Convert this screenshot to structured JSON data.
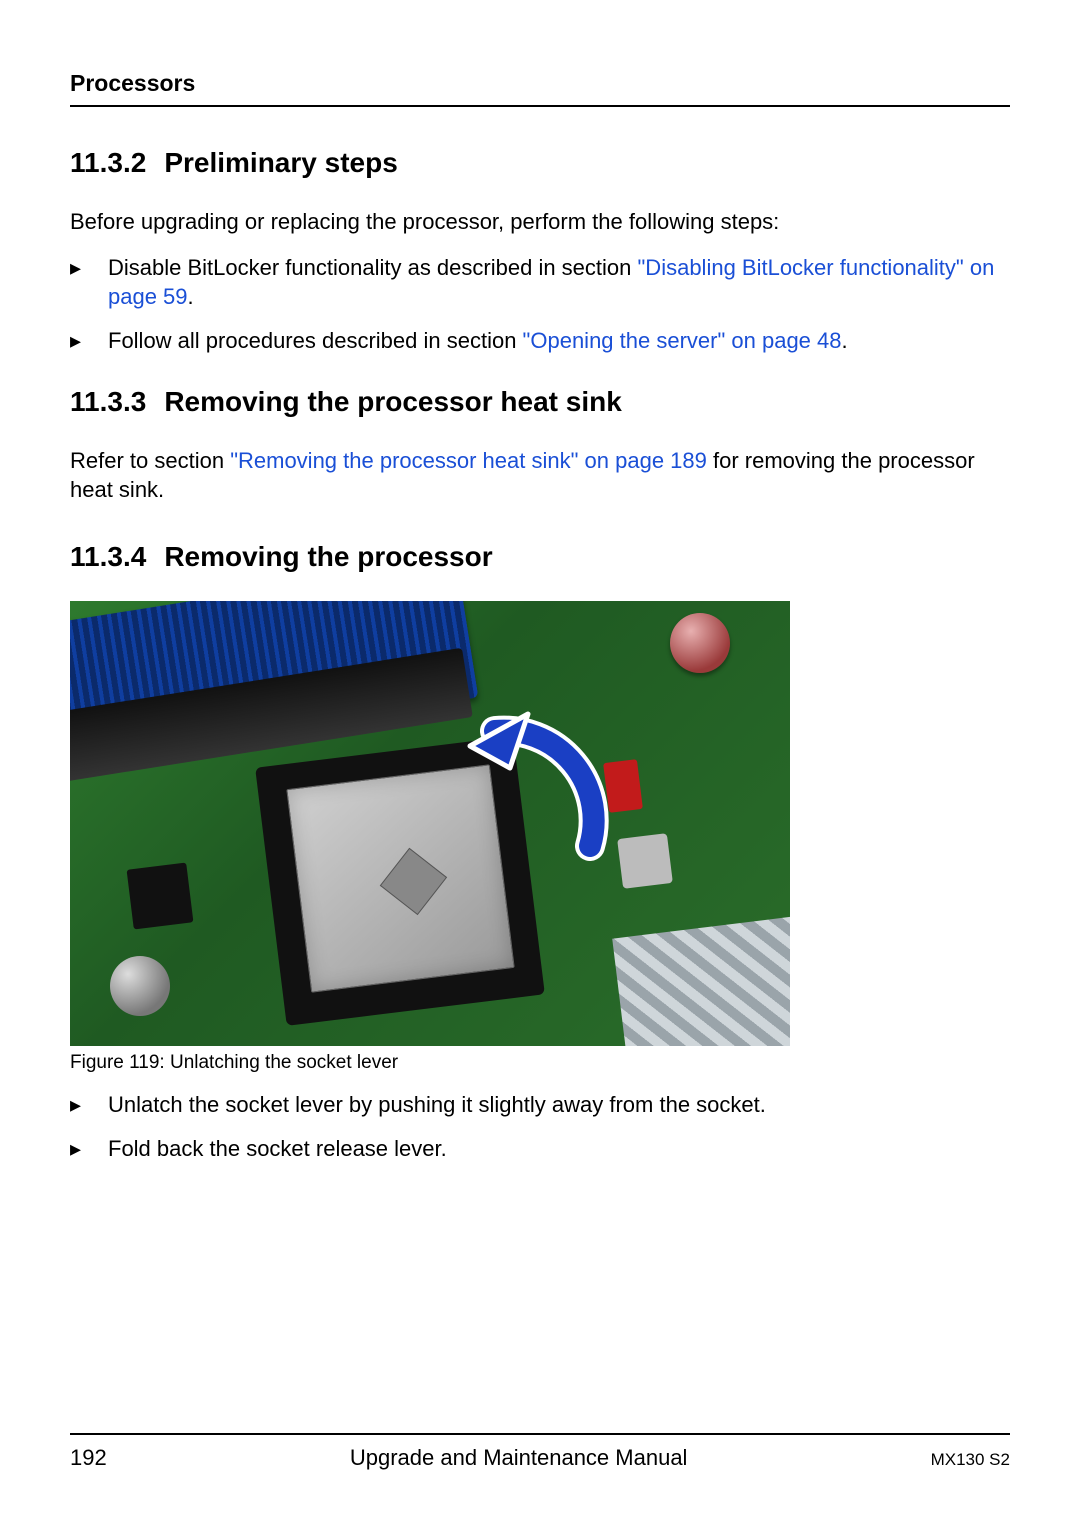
{
  "header": {
    "chapter": "Processors"
  },
  "sections": {
    "s1": {
      "num": "11.3.2",
      "title": "Preliminary steps"
    },
    "s2": {
      "num": "11.3.3",
      "title": "Removing the processor heat sink"
    },
    "s3": {
      "num": "11.3.4",
      "title": "Removing the processor"
    }
  },
  "para": {
    "intro": "Before upgrading or replacing the processor, perform the following steps:",
    "heat_pre": "Refer to section ",
    "heat_link": "\"Removing the processor heat sink\" on page 189",
    "heat_post": " for removing the processor heat sink."
  },
  "bullets1": {
    "b1_pre": "Disable BitLocker functionality as described in section ",
    "b1_link": "\"Disabling BitLocker functionality\" on page 59",
    "b1_post": ".",
    "b2_pre": "Follow all procedures described in section ",
    "b2_link": "\"Opening the server\" on page 48",
    "b2_post": "."
  },
  "figure": {
    "caption": "Figure 119: Unlatching the socket lever"
  },
  "bullets2": {
    "b1": "Unlatch the socket lever by pushing it slightly away from the socket.",
    "b2": "Fold back the socket release lever."
  },
  "footer": {
    "page": "192",
    "manual": "Upgrade and Maintenance Manual",
    "model": "MX130 S2"
  }
}
